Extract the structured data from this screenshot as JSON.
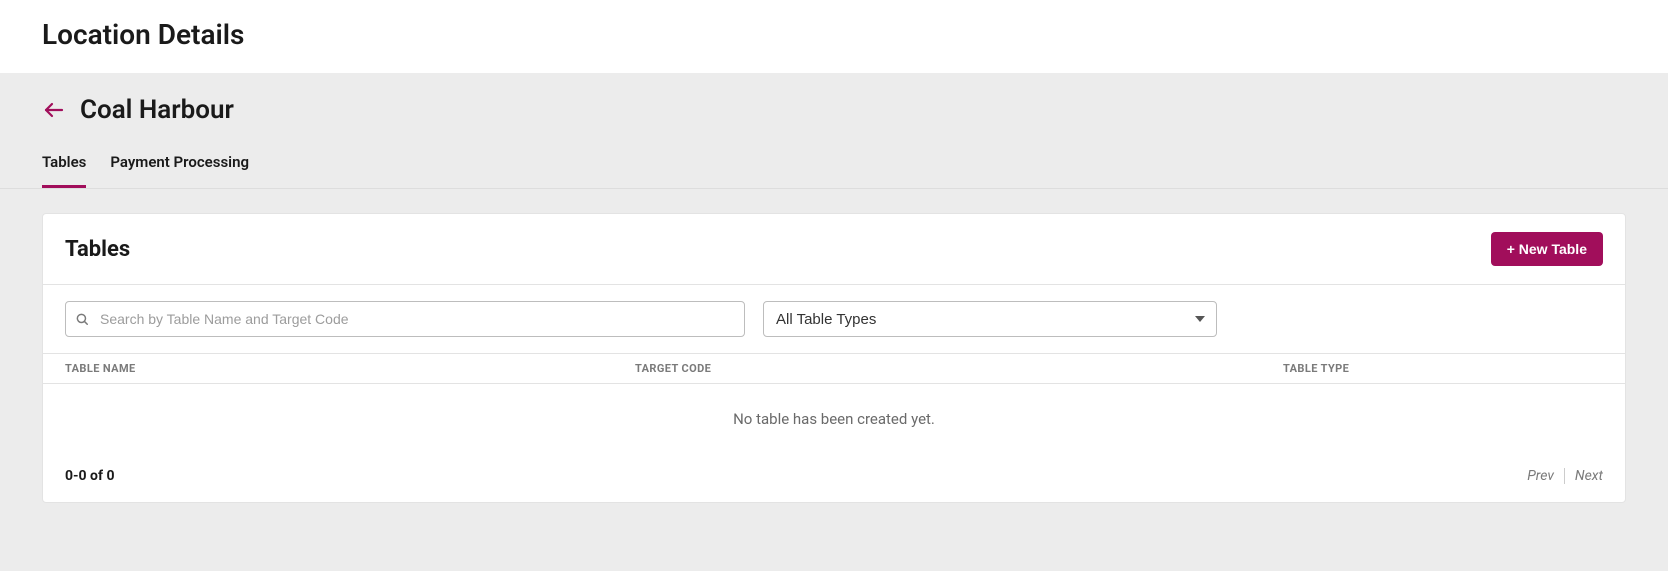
{
  "page": {
    "title": "Location Details",
    "location_name": "Coal Harbour"
  },
  "tabs": [
    {
      "label": "Tables",
      "active": true
    },
    {
      "label": "Payment Processing",
      "active": false
    }
  ],
  "card": {
    "title": "Tables",
    "new_button_label": "+ New Table"
  },
  "filters": {
    "search_placeholder": "Search by Table Name and Target Code",
    "type_select_value": "All Table Types"
  },
  "table": {
    "columns": {
      "name": "TABLE NAME",
      "target_code": "TARGET CODE",
      "type": "TABLE TYPE"
    },
    "rows": [],
    "empty_message": "No table has been created yet."
  },
  "pagination": {
    "range_text": "0-0 of 0",
    "prev_label": "Prev",
    "next_label": "Next"
  }
}
